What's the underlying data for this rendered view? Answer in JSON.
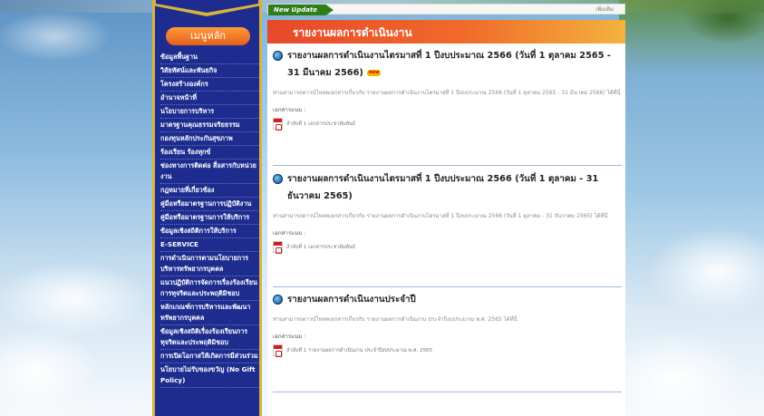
{
  "menu": {
    "heading": "เมนูหลัก",
    "items": [
      "ข้อมูลพื้นฐาน",
      "วิสัยทัศน์และพันธกิจ",
      "โครงสร้างองค์กร",
      "อำนาจหน้าที่",
      "นโยบายการบริหาร",
      "มาตรฐานคุณธรรมจริยธรรม",
      "กองทุนหลักประกันสุขภาพ",
      "ร้องเรียน ร้องทุกข์",
      "ช่องทางการติดต่อ สื่อสารกับหน่วยงาน",
      "กฎหมายที่เกี่ยวข้อง",
      "คู่มือหรือมาตรฐานการปฏิบัติงาน",
      "คู่มือหรือมาตรฐานการให้บริการ",
      "ข้อมูลเชิงสถิติการให้บริการ",
      "E-SERVICE",
      "การดำเนินการตามนโยบายการบริหารทรัพยากรบุคคล",
      "แนวปฏิบัติการจัดการเรื่องร้องเรียนการทุจริตและประพฤติมิชอบ",
      "หลักเกณฑ์การบริหารและพัฒนาทรัพยากรบุคคล",
      "ข้อมูลเชิงสถิติเรื่องร้องเรียนการทุจริตและประพฤติมิชอบ",
      "การเปิดโอกาสให้เกิดการมีส่วนร่วม",
      "นโยบายไม่รับของขวัญ (No Gift Policy)"
    ]
  },
  "update_bar": {
    "tag": "New Update",
    "more": "เพิ่มเติม"
  },
  "page": {
    "title": "รายงานผลการดำเนินงาน"
  },
  "articles": [
    {
      "title": "รายงานผลการดำเนินงานไตรมาสที่ 1 ปีงบประมาณ 2566 (วันที่ 1 ตุลาคม 2565 - 31 มีนาคม 2566)",
      "badge": "new",
      "description": "ท่านสามารถดาวน์โหลดเอกสารเกี่ยวกับ รายงานผลการดำเนินงานไตรมาสที่ 1 ปีงบประมาณ 2566 (วันที่ 1 ตุลาคม 2565 - 31 มีนาคม 2566) ได้ที่นี่",
      "attachments_label": "เอกสารแนบ :",
      "attachment": "ลำดับที่ 1 เอกสารประชาสัมพันธ์"
    },
    {
      "title": "รายงานผลการดำเนินงานไตรมาสที่ 1 ปีงบประมาณ 2566 (วันที่ 1 ตุลาคม - 31 ธันวาคม 2565)",
      "badge": "",
      "description": "ท่านสามารถดาวน์โหลดเอกสารเกี่ยวกับ รายงานผลการดำเนินงานไตรมาสที่ 1 ปีงบประมาณ 2566 (วันที่ 1 ตุลาคม - 31 ธันวาคม 2565) ได้ที่นี่",
      "attachments_label": "เอกสารแนบ :",
      "attachment": "ลำดับที่ 1 เอกสารประชาสัมพันธ์"
    },
    {
      "title": "รายงานผลการดำเนินงานประจำปี",
      "badge": "",
      "description": "ท่านสามารถดาวน์โหลดเอกสารเกี่ยวกับ รายงานผลการดำเนินงาน ประจำปีงบประมาณ พ.ศ. 2565 ได้ที่นี่",
      "attachments_label": "เอกสารแนบ :",
      "attachment": "ลำดับที่ 1 รายงานผลการดำเนินงาน ประจำปีงบประมาณ พ.ศ. 2565"
    }
  ]
}
